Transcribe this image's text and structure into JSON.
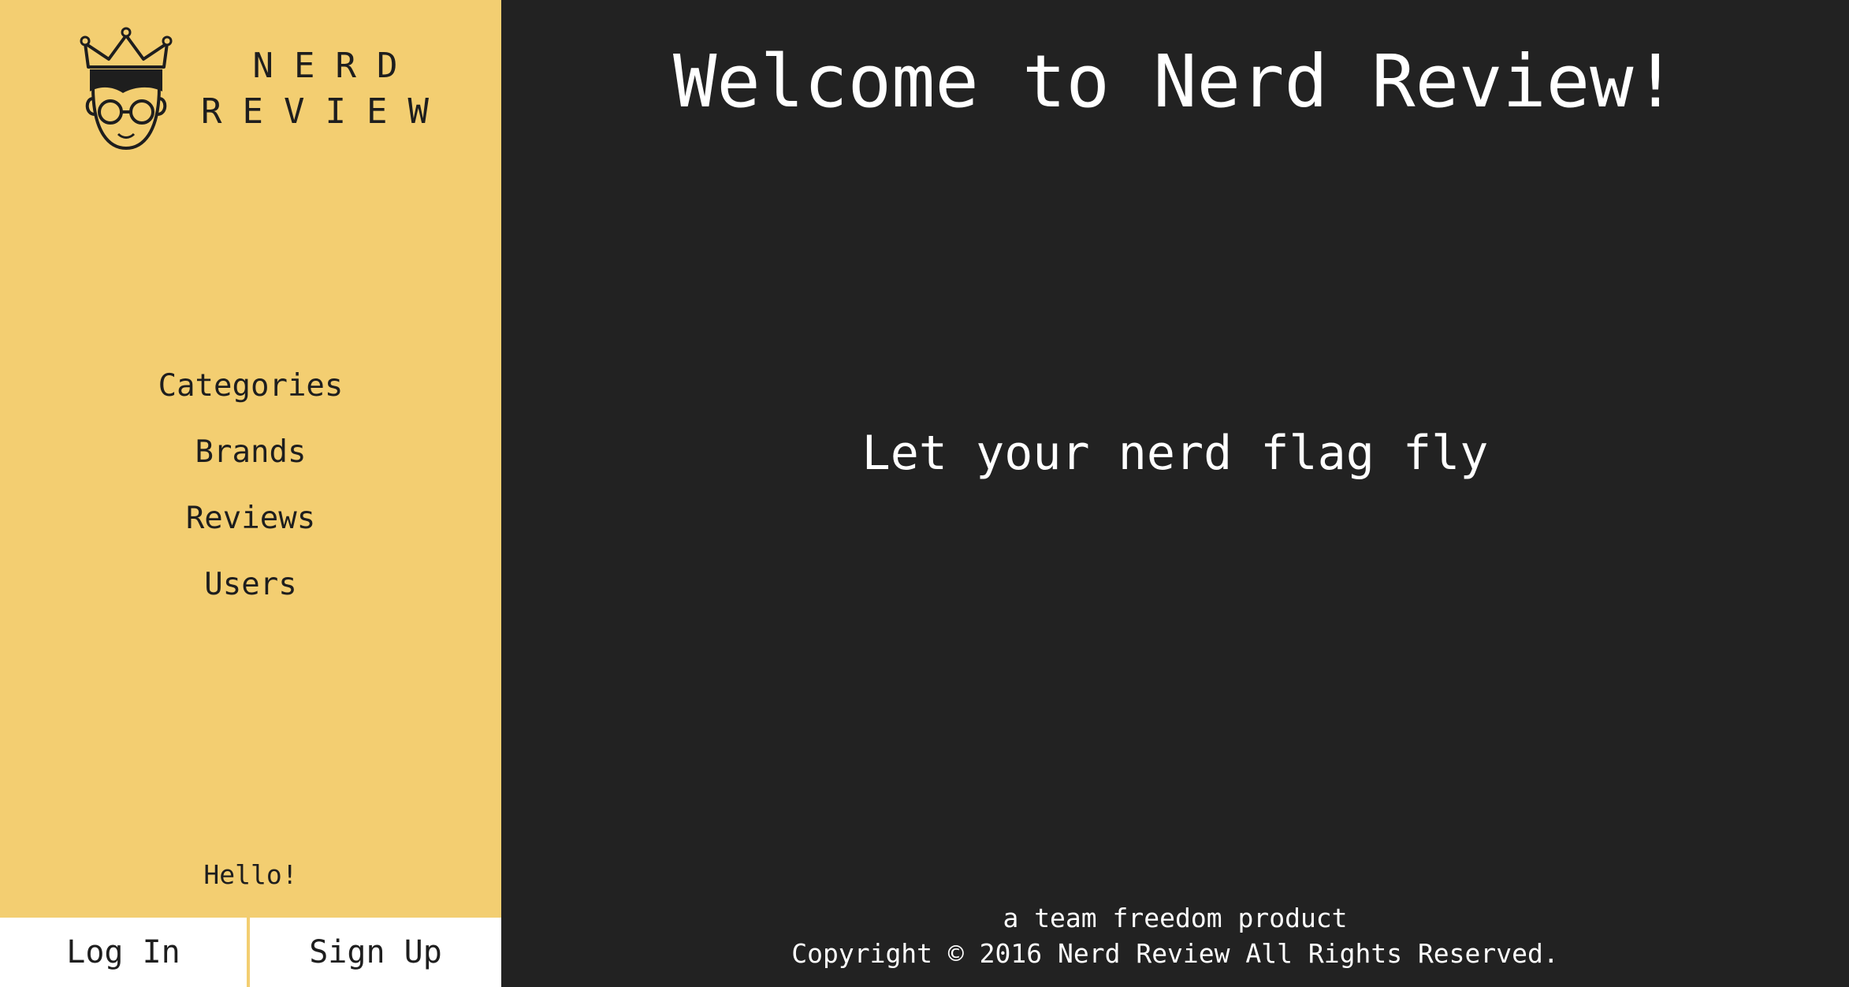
{
  "brand": {
    "line1": "NERD",
    "line2": "REVIEW",
    "logo_icon": "nerd-king-icon"
  },
  "sidebar": {
    "nav": [
      {
        "label": "Categories"
      },
      {
        "label": "Brands"
      },
      {
        "label": "Reviews"
      },
      {
        "label": "Users"
      }
    ],
    "greeting": "Hello!",
    "login_label": "Log In",
    "signup_label": "Sign Up"
  },
  "main": {
    "title": "Welcome to Nerd Review!",
    "tagline": "Let your nerd flag fly"
  },
  "footer": {
    "credit": "a team freedom product",
    "copyright": "Copyright © 2016 Nerd Review All Rights Reserved."
  },
  "colors": {
    "sidebar_bg": "#F3CE71",
    "main_bg": "#222222",
    "text_dark": "#1E1E1E",
    "text_light": "#FFFFFF"
  }
}
